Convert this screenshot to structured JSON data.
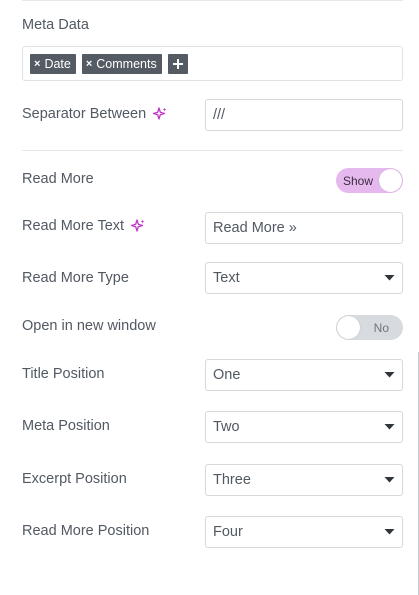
{
  "meta_data": {
    "label": "Meta Data",
    "tags": [
      {
        "label": "Date"
      },
      {
        "label": "Comments"
      }
    ],
    "remove_glyph": "×",
    "add_glyph": "+"
  },
  "separator": {
    "label": "Separator Between",
    "value": "///"
  },
  "read_more": {
    "label": "Read More",
    "toggle_text": "Show",
    "enabled": true
  },
  "read_more_text": {
    "label": "Read More Text",
    "value": "Read More »"
  },
  "read_more_type": {
    "label": "Read More Type",
    "value": "Text"
  },
  "new_window": {
    "label": "Open in new window",
    "toggle_text": "No",
    "enabled": false
  },
  "title_position": {
    "label": "Title Position",
    "value": "One"
  },
  "meta_position": {
    "label": "Meta Position",
    "value": "Two"
  },
  "excerpt_position": {
    "label": "Excerpt Position",
    "value": "Three"
  },
  "read_more_position": {
    "label": "Read More Position",
    "value": "Four"
  },
  "colors": {
    "ai_icon": "#c036c7",
    "toggle_on": "#e6b9ee",
    "tag_bg": "#545b63"
  },
  "icons": {
    "ai": "sparkle-icon",
    "dropdown": "chevron-down-icon"
  }
}
